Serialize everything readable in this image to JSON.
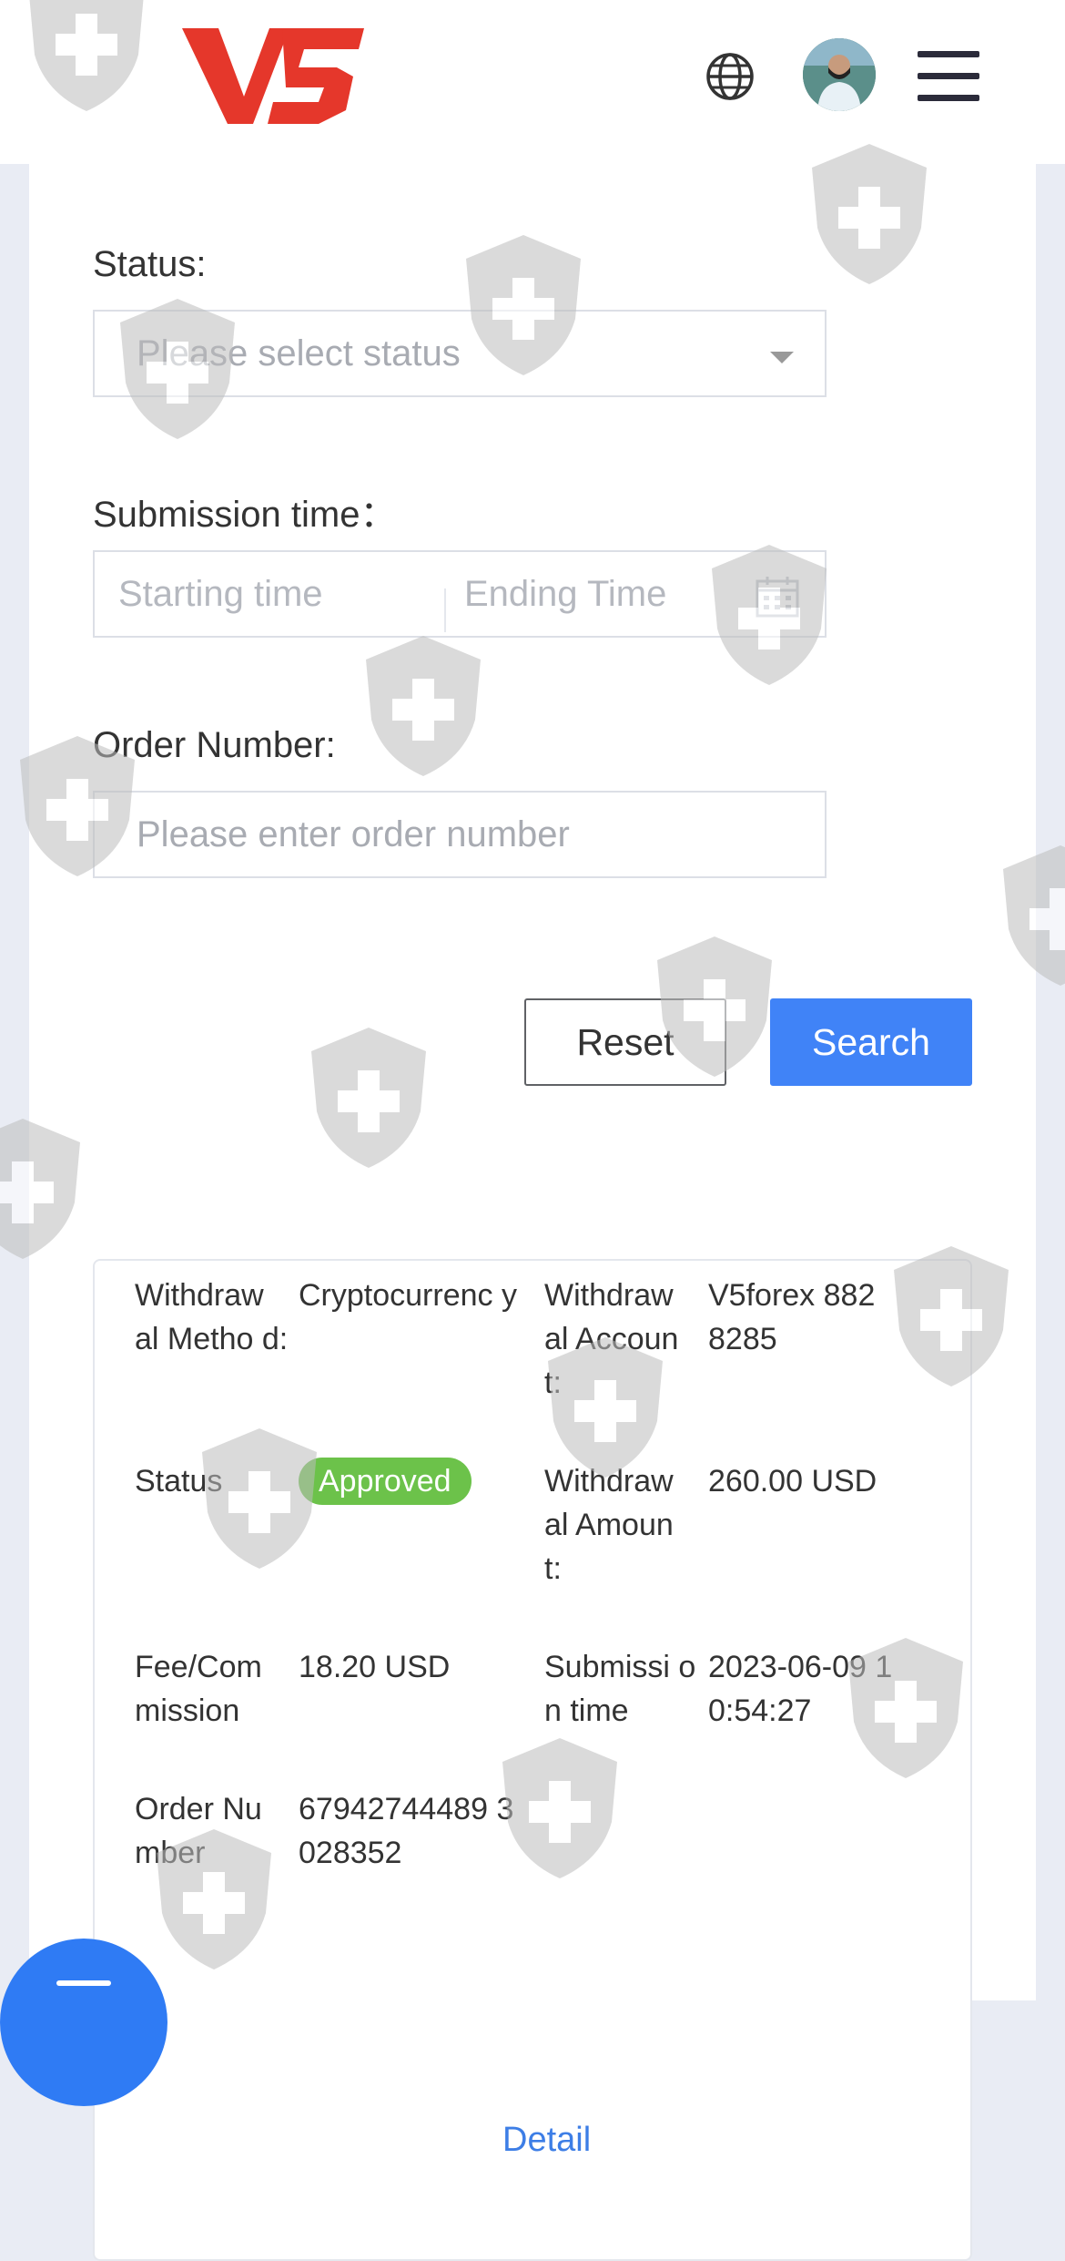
{
  "header": {
    "logo_text": "V5",
    "icons": [
      "globe-icon",
      "avatar",
      "menu-icon"
    ]
  },
  "filters": {
    "status_label": "Status:",
    "status_placeholder": "Please select status",
    "time_label": "Submission time：",
    "start_placeholder": "Starting time",
    "end_placeholder": "Ending Time",
    "order_label": "Order Number:",
    "order_placeholder": "Please enter order number",
    "reset_label": "Reset",
    "search_label": "Search"
  },
  "record": {
    "method_label": "Withdraw al Metho d:",
    "method_value": "Cryptocurrenc y",
    "account_label": "Withdraw al Accoun t:",
    "account_value": "V5forex 8828285",
    "status_label": "Status",
    "status_value": "Approved",
    "amount_label": "Withdraw al Amoun t:",
    "amount_value": "260.00 USD",
    "fee_label": "Fee/Com mission",
    "fee_value": "18.20 USD",
    "time_label": "Submissi on time",
    "time_value": "2023-06-09 1 0:54:27",
    "order_label": "Order Nu mber",
    "order_value": "67942744489 3028352",
    "detail_label": "Detail"
  },
  "colors": {
    "accent": "#4083f7",
    "approved": "#6cc24a",
    "logo": "#e5372b",
    "watermark": "#cfcfcf"
  }
}
